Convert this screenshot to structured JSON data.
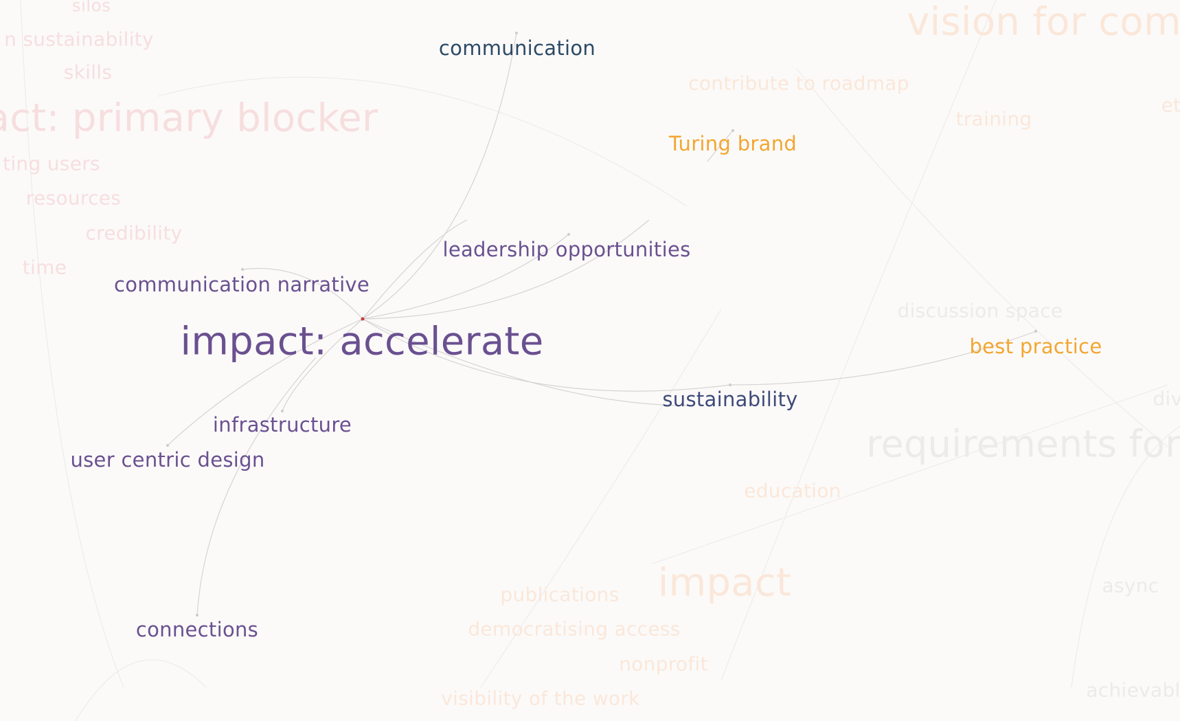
{
  "colors": {
    "background": "#fbfaf9",
    "focus_purple": "#6a5090",
    "navy": "#2c4a66",
    "slate": "#3f4a78",
    "orange": "#f3a630",
    "faded_pink": "#f7dede",
    "faded_peach": "#fbe7d9",
    "faded_gray": "#eceaea",
    "edge": "#d6d3d3",
    "focus_dot": "#c43d3d"
  },
  "focus_node": {
    "label": "impact: accelerate"
  },
  "labels": {
    "silos": "silos",
    "sustainability_partial": "n sustainability",
    "skills": "skills",
    "primary_blocker": "act: primary blocker",
    "existing_users": "ting users",
    "resources": "resources",
    "credibility": "credibility",
    "time": "time",
    "communication": "communication",
    "vision": "vision for com",
    "contribute": "contribute to roadmap",
    "training": "training",
    "et": "et",
    "turing_brand": "Turing brand",
    "leadership": "leadership opportunities",
    "comm_narrative": "communication narrative",
    "impact_accelerate": "impact: accelerate",
    "discussion": "discussion space",
    "best_practice": "best practice",
    "sustainability": "sustainability",
    "div": "div",
    "infrastructure": "infrastructure",
    "requirements": "requirements for",
    "user_centric": "user centric design",
    "education": "education",
    "impact": "impact",
    "publications": "publications",
    "async": "async",
    "connections": "connections",
    "democratising": "democratising access",
    "nonprofit": "nonprofit",
    "visibility": "visibility of the work",
    "achievable": "achievabl"
  }
}
